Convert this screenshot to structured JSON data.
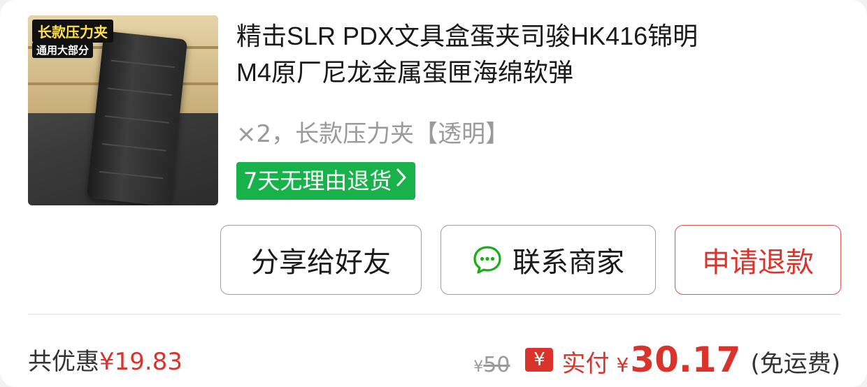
{
  "product": {
    "image_badge": "长款压力夹",
    "image_badge_sub": "通用大部分",
    "title_line1": "精击SLR PDX文具盒蛋夹司骏HK416锦明",
    "title_line2": "M4原厂尼龙金属蛋匣海绵软弹",
    "variant": "×2，长款压力夹【透明】",
    "return_tag": "7天无理由退货",
    "return_tag_icon": "chevron-right-icon"
  },
  "actions": {
    "share_label": "分享给好友",
    "contact_label": "联系商家",
    "contact_icon": "chat-bubble-icon",
    "refund_label": "申请退款"
  },
  "summary": {
    "discount_label": "共优惠",
    "discount_amount": "¥19.83",
    "original_currency": "¥",
    "original_price": "50",
    "paid_icon_glyph": "¥",
    "paid_label": "实付",
    "paid_currency": "¥",
    "paid_amount": "30.17",
    "shipping_note": "(免运费)"
  },
  "colors": {
    "accent_red": "#d9332b",
    "return_green": "#17b24a",
    "chat_green": "#1aad19"
  }
}
